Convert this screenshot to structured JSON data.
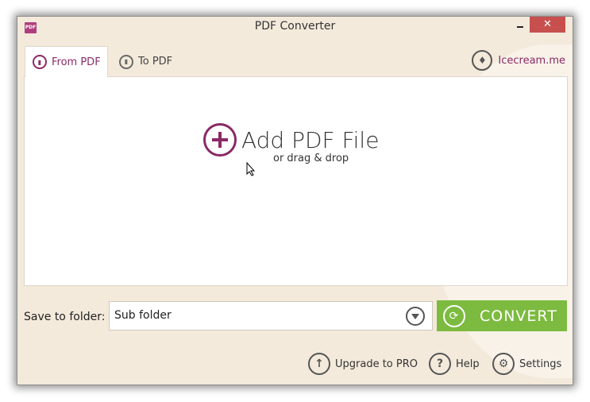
{
  "window": {
    "title": "PDF Converter",
    "app_icon_label": "PDF",
    "minimize_label": "",
    "close_label": "✕"
  },
  "tabs": [
    {
      "label": "From PDF",
      "active": true,
      "icon": "from-pdf-icon"
    },
    {
      "label": "To PDF",
      "active": false,
      "icon": "to-pdf-icon"
    }
  ],
  "brand": {
    "label": "Icecream.me",
    "icon": "icecream-icon"
  },
  "drop_area": {
    "title": "Add PDF File",
    "subtitle": "or drag & drop"
  },
  "save": {
    "label": "Save to folder:",
    "selected": "Sub folder"
  },
  "convert": {
    "label": "CONVERT",
    "icon": "refresh-icon"
  },
  "footer": [
    {
      "label": "Upgrade to PRO",
      "icon": "arrow-up-icon",
      "glyph": "↑"
    },
    {
      "label": "Help",
      "icon": "question-icon",
      "glyph": "?"
    },
    {
      "label": "Settings",
      "icon": "gear-icon",
      "glyph": "⚙"
    }
  ],
  "colors": {
    "accent": "#8a2a66",
    "convert_green": "#7cbb3f",
    "close_red": "#c7504f",
    "background": "#f3eadb"
  }
}
